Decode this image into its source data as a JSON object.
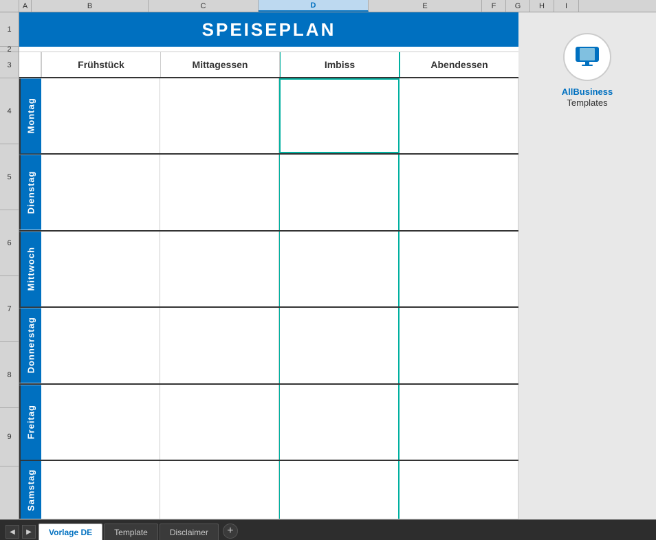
{
  "title": "SPEISEPLAN",
  "columns": [
    "A",
    "B",
    "C",
    "D",
    "E",
    "F",
    "G",
    "H",
    "I"
  ],
  "rows": [
    "1",
    "2",
    "3",
    "4",
    "5",
    "6",
    "7",
    "8",
    "9"
  ],
  "meal_headers": [
    {
      "id": "fruehstueck",
      "label": "Frühstück"
    },
    {
      "id": "mittagessen",
      "label": "Mittagessen"
    },
    {
      "id": "imbiss",
      "label": "Imbiss"
    },
    {
      "id": "abendessen",
      "label": "Abendessen"
    }
  ],
  "days": [
    {
      "id": "montag",
      "label": "Montag"
    },
    {
      "id": "dienstag",
      "label": "Dienstag"
    },
    {
      "id": "mittwoch",
      "label": "Mittwoch"
    },
    {
      "id": "donnerstag",
      "label": "Donnerstag"
    },
    {
      "id": "freitag",
      "label": "Freitag"
    },
    {
      "id": "samstag",
      "label": "Samstag"
    }
  ],
  "tabs": [
    {
      "id": "vorlage-de",
      "label": "Vorlage DE",
      "active": true
    },
    {
      "id": "template",
      "label": "Template",
      "active": false
    },
    {
      "id": "disclaimer",
      "label": "Disclaimer",
      "active": false
    }
  ],
  "logo": {
    "line1": "AllBusiness",
    "line2": "Templates"
  },
  "nav_prev": "◀",
  "nav_next": "▶",
  "add_sheet": "+",
  "colors": {
    "title_bg": "#0070C0",
    "day_label_bg": "#0070C0",
    "imbiss_border": "#00B0A0",
    "tab_active_color": "#0070C0"
  }
}
